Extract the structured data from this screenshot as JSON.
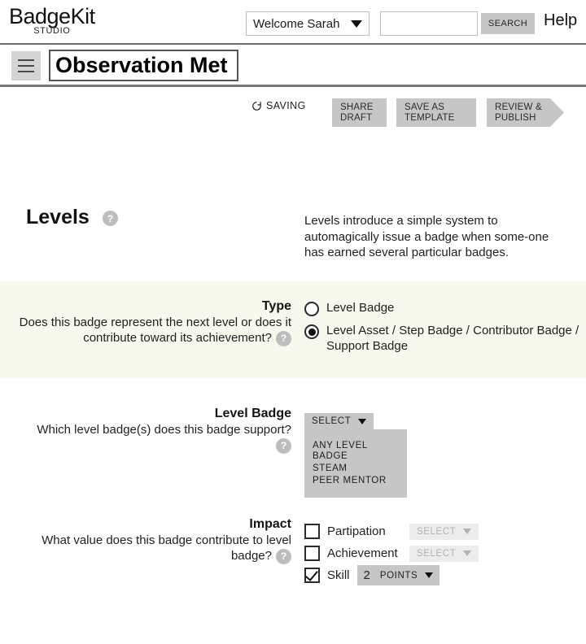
{
  "header": {
    "brand_name": "BadgeKit",
    "brand_sub": "STUDIO",
    "account_label": "Welcome Sarah",
    "search_placeholder": "",
    "search_value": "",
    "search_button": "SEARCH",
    "help_label": "Help"
  },
  "toolbar": {
    "menu_icon": "hamburger-icon",
    "badge_title": "Observation Met",
    "badge_title_placeholder": "Badge name",
    "saving_status": "SAVING",
    "saving_icon": "refresh-spinner-icon",
    "share_draft": "SHARE\nDRAFT",
    "share_draft_line1": "SHARE",
    "share_draft_line2": "DRAFT",
    "save_template_line1": "SAVE AS",
    "save_template_line2": "TEMPLATE",
    "review_publish_line1": "REVIEW &",
    "review_publish_line2": "PUBLISH"
  },
  "section": {
    "title": "Levels",
    "help_glyph": "?",
    "description": "Levels introduce a simple system to automagically issue a badge when some-one has earned several particular badges."
  },
  "type_row": {
    "label": "Type",
    "description": "Does this badge represent the next level or does it contribute toward its achievement?",
    "help_glyph": "?",
    "options": [
      {
        "label": "Level Badge",
        "checked": false
      },
      {
        "label": "Level Asset / Step Badge / Contributor Badge / Support Badge",
        "checked": true
      }
    ]
  },
  "level_badge_row": {
    "label": "Level Badge",
    "description": "Which level badge(s) does this badge support?",
    "help_glyph": "?",
    "select_label": "SELECT",
    "options": [
      "ANY LEVEL BADGE",
      "STEAM",
      "PEER MENTOR"
    ]
  },
  "impact_row": {
    "label": "Impact",
    "description": "What value does this badge contribute to level badge?",
    "help_glyph": "?",
    "items": [
      {
        "label": "Partipation",
        "checked": false,
        "select_label": "SELECT",
        "disabled": true
      },
      {
        "label": "Achievement",
        "checked": false,
        "select_label": "SELECT",
        "disabled": true
      },
      {
        "label": "Skill",
        "checked": true,
        "value_number": "2",
        "value_unit": "POINTS",
        "disabled": false
      }
    ]
  },
  "colors": {
    "button_gray": "#c6c6c6",
    "tint_band": "#f7f9ef",
    "help_dot": "#bdbdbd",
    "disabled_text": "#b2b2b2"
  }
}
